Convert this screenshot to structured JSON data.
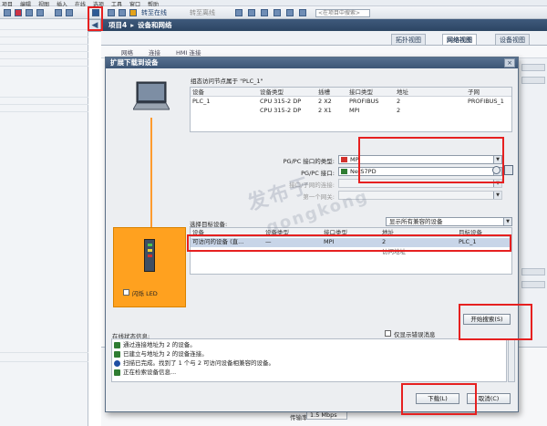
{
  "app": {
    "menu": [
      "项目",
      "编辑",
      "视图",
      "插入",
      "在线",
      "选项",
      "工具",
      "窗口",
      "帮助"
    ],
    "toolbar": {
      "go_online": "转至在线",
      "go_offline": "转至离线",
      "search_placeholder": "<在项目中搜索>"
    },
    "breadcrumb": [
      "项目4",
      "设备和网络"
    ],
    "view_tabs": [
      "拓扑视图",
      "网络视图",
      "设备视图"
    ],
    "editor_tools": {
      "network": "网络",
      "connections": "连接",
      "hmi": "HMI 连接"
    },
    "properties": {
      "rate_label": "传输率:",
      "rate_value": "1.5 Mbps"
    },
    "watermark": [
      "发布于",
      "gongkong"
    ]
  },
  "dialog": {
    "title": "扩展下载到设备",
    "close": "×",
    "node_caption": "组态访问节点属于 \"PLC_1\"",
    "node_table": {
      "headers": [
        "设备",
        "设备类型",
        "插槽",
        "接口类型",
        "地址",
        "子网"
      ],
      "rows": [
        [
          "PLC_1",
          "CPU 315-2 DP",
          "2 X2",
          "PROFIBUS",
          "2",
          "PROFIBUS_1"
        ],
        [
          "",
          "CPU 315-2 DP",
          "2 X1",
          "MPI",
          "2",
          ""
        ]
      ]
    },
    "interface_form": {
      "type_label": "PG/PC 接口的类型:",
      "type_value": "MPI",
      "iface_label": "PG/PC 接口:",
      "iface_value": "NetS7PD",
      "subnet_label": "接口/子网的连接:",
      "gateway_label": "第一个网关:"
    },
    "target": {
      "label": "选择目标设备:",
      "filter_value": "显示所有兼容的设备",
      "headers": [
        "设备",
        "设备类型",
        "接口类型",
        "地址",
        "目标设备"
      ],
      "rows": [
        [
          "可访问的设备 (直...",
          "—",
          "MPI",
          "2",
          "PLC_1"
        ],
        [
          "",
          "",
          "",
          "访问地址",
          ""
        ]
      ]
    },
    "flash_led": "闪烁 LED",
    "start_search": "开始搜索(S)",
    "status": {
      "label": "在线状态信息:",
      "errors_only": "仅显示错误消息",
      "messages": [
        {
          "text": "通过连接地址为 2 的设备。",
          "color": "#2f7d32"
        },
        {
          "text": "已建立与地址为 2 的设备连接。",
          "color": "#2f7d32"
        },
        {
          "text": "扫描已完成。找到了 1 个与 2 可访问设备相兼容的设备。",
          "color": "#1f4fa3"
        },
        {
          "text": "正在检索设备信息...",
          "color": "#2f7d32"
        }
      ]
    },
    "download": "下载(L)",
    "cancel": "取消(C)"
  }
}
